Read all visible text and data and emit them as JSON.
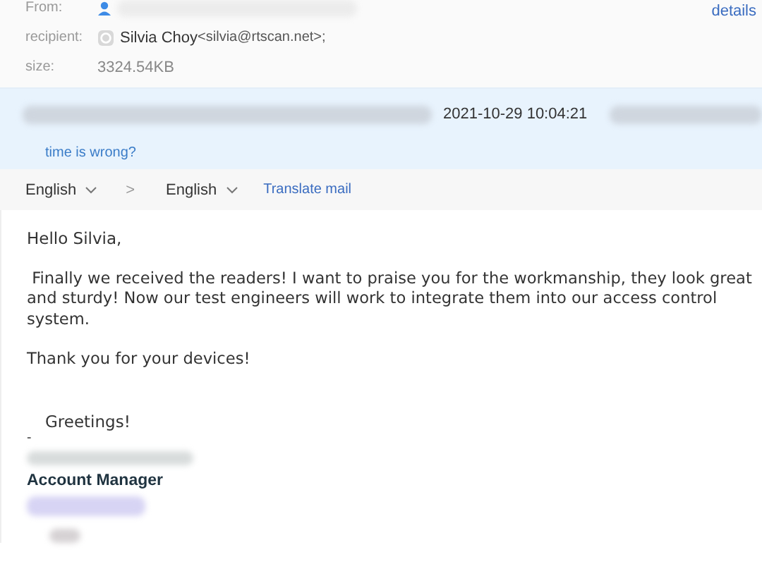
{
  "header": {
    "from_label": "From:",
    "details_link": "details",
    "recipient_label": "recipient:",
    "recipient_name": "Silvia Choy",
    "recipient_email": "<silvia@rtscan.net>;",
    "size_label": "size:",
    "size_value": "3324.54KB"
  },
  "time_band": {
    "timestamp": "2021-10-29 10:04:21",
    "time_link": "time is wrong?"
  },
  "translate_bar": {
    "source_language": "English",
    "separator": ">",
    "target_language": "English",
    "translate_link": "Translate mail"
  },
  "body": {
    "greeting": "Hello Silvia,",
    "paragraphs": [
      " Finally we received the readers! I want to praise you for the workmanship, they look great and sturdy! Now our test engineers will work to integrate them into our access control system.",
      "Thank you for your devices!"
    ],
    "closing": "Greetings!",
    "dash": "-",
    "signature_title": "Account Manager"
  }
}
